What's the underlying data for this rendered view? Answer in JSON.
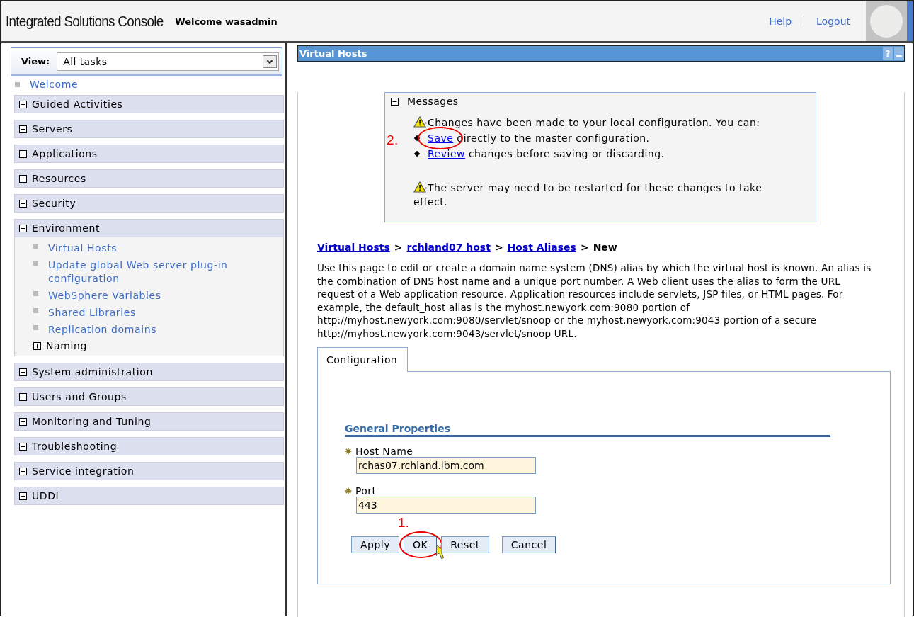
{
  "header": {
    "title": "Integrated Solutions Console",
    "welcome": "Welcome wasadmin",
    "links": [
      {
        "label": "Help"
      },
      {
        "label": "Logout"
      }
    ]
  },
  "nav": {
    "view_label": "View:",
    "view_value": "All tasks",
    "welcome_link": "Welcome",
    "sections": [
      {
        "label": "Guided Activities",
        "expanded": false
      },
      {
        "label": "Servers",
        "expanded": false
      },
      {
        "label": "Applications",
        "expanded": false
      },
      {
        "label": "Resources",
        "expanded": false
      },
      {
        "label": "Security",
        "expanded": false
      },
      {
        "label": "Environment",
        "expanded": true,
        "children": [
          {
            "kind": "link",
            "label": "Virtual Hosts"
          },
          {
            "kind": "link",
            "label": "Update global Web server plug-in configuration"
          },
          {
            "kind": "link",
            "label": "WebSphere Variables"
          },
          {
            "kind": "link",
            "label": "Shared Libraries"
          },
          {
            "kind": "link",
            "label": "Replication domains"
          },
          {
            "kind": "group",
            "label": "Naming",
            "expanded": false
          }
        ]
      },
      {
        "label": "System administration",
        "expanded": false
      },
      {
        "label": "Users and Groups",
        "expanded": false
      },
      {
        "label": "Monitoring and Tuning",
        "expanded": false
      },
      {
        "label": "Troubleshooting",
        "expanded": false
      },
      {
        "label": "Service integration",
        "expanded": false
      },
      {
        "label": "UDDI",
        "expanded": false
      }
    ]
  },
  "portlet": {
    "title": "Virtual Hosts",
    "help_button": "?",
    "messages": {
      "title": "Messages",
      "expanded": true,
      "warning": "Changes have been made to your local configuration. You can:",
      "options": [
        {
          "link": "Save",
          "text": "directly to the master configuration.",
          "callout": "2."
        },
        {
          "link": "Review",
          "text": "changes before saving or discarding."
        }
      ],
      "note": "The server may need to be restarted for these changes to take effect."
    },
    "breadcrumb": {
      "separator": ">",
      "items": [
        {
          "label": "Virtual Hosts",
          "link": true
        },
        {
          "label": "rchland07 host",
          "link": true
        },
        {
          "label": "Host Aliases",
          "link": true
        },
        {
          "label": "New",
          "link": false
        }
      ]
    },
    "description": "Use this page to edit or create a domain name system (DNS) alias by which the virtual host is known. An alias is the combination of DNS host name and a unique port number. A Web client uses the alias to form the URL request of a Web application resource. Application resources include servlets, JSP files, or HTML pages. For example, the default_host alias is the myhost.newyork.com:9080 portion of http://myhost.newyork.com:9080/servlet/snoop or the myhost.newyork.com:9043 portion of a secure http://myhost.newyork.com:9043/servlet/snoop URL.",
    "tabs": [
      {
        "label": "Configuration",
        "selected": true
      }
    ],
    "section_title": "General Properties",
    "fields": [
      {
        "label": "Host Name",
        "required": true,
        "value": "rchas07.rchland.ibm.com"
      },
      {
        "label": "Port",
        "required": true,
        "value": "443"
      }
    ],
    "buttons": [
      {
        "label": "Apply"
      },
      {
        "label": "OK",
        "callout": "1."
      },
      {
        "label": "Reset"
      },
      {
        "label": "Cancel"
      }
    ]
  }
}
